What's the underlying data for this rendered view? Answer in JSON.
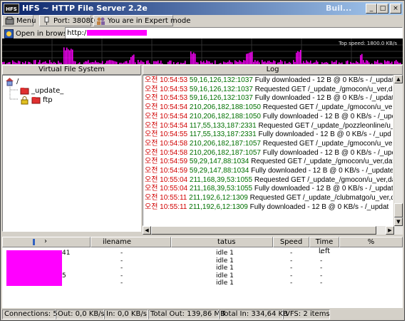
{
  "window": {
    "title": "HFS ~ HTTP File Server 2.2e",
    "title_right": "Buil...",
    "icon_label": "HFS",
    "controls": [
      "_",
      "□",
      "×"
    ]
  },
  "toolbar": {
    "menu_label": "Menu",
    "port_label": "Port: 38080",
    "mode_label": "You are in Expert mode"
  },
  "address": {
    "open_label": "Open in browser",
    "url_prefix": "http:/"
  },
  "graph": {
    "top_speed": "Top speed: 1800.0 KB/s"
  },
  "vfs": {
    "header": "Virtual File System",
    "root": "/",
    "items": [
      "_update_",
      "ftp"
    ]
  },
  "log": {
    "header": "Log",
    "entries": [
      {
        "ts": "오전 10:54:53",
        "ip": "59,16,126,132:1037",
        "msg": "Fully downloaded - 12 B @ 0 KB/s - /_update_"
      },
      {
        "ts": "오전 10:54:53",
        "ip": "59,16,126,132:1037",
        "msg": "Requested GET /_update_/gmocon/u_ver,dat"
      },
      {
        "ts": "오전 10:54:53",
        "ip": "59,16,126,132:1037",
        "msg": "Fully downloaded - 12 B @ 0 KB/s - /_update"
      },
      {
        "ts": "오전 10:54:54",
        "ip": "210,206,182,188:1050",
        "msg": "Requested GET /_update_/gmocon/u_ver,d"
      },
      {
        "ts": "오전 10:54:54",
        "ip": "210,206,182,188:1050",
        "msg": "Fully downloaded - 12 B @ 0 KB/s - /_upd"
      },
      {
        "ts": "오전 10:54:54",
        "ip": "117,55,133,187:2331",
        "msg": "Requested GET /_update_/pozzleonline/u_v"
      },
      {
        "ts": "오전 10:54:55",
        "ip": "117,55,133,187:2331",
        "msg": "Fully downloaded - 12 B @ 0 KB/s - /_upd"
      },
      {
        "ts": "오전 10:54:58",
        "ip": "210,206,182,187:1057",
        "msg": "Requested GET /_update_/gmocon/u_ver,d"
      },
      {
        "ts": "오전 10:54:58",
        "ip": "210,206,182,187:1057",
        "msg": "Fully downloaded - 12 B @ 0 KB/s - /_upd"
      },
      {
        "ts": "오전 10:54:59",
        "ip": "59,29,147,88:1034",
        "msg": "Requested GET /_update_/gmocon/u_ver,dat"
      },
      {
        "ts": "오전 10:54:59",
        "ip": "59,29,147,88:1034",
        "msg": "Fully downloaded - 12 B @ 0 KB/s - /_update"
      },
      {
        "ts": "오전 10:55:04",
        "ip": "211,168,39,53:1055",
        "msg": "Requested GET /_update_/gmocon/u_ver,dat"
      },
      {
        "ts": "오전 10:55:04",
        "ip": "211,168,39,53:1055",
        "msg": "Fully downloaded - 12 B @ 0 KB/s - /_updat"
      },
      {
        "ts": "오전 10:55:11",
        "ip": "211,192,6,12:1309",
        "msg": "Requested GET /_update_/clubmatgo/u_ver,da"
      },
      {
        "ts": "오전 10:55:11",
        "ip": "211,192,6,12:1309",
        "msg": "Fully downloaded - 12 B @ 0 KB/s - /_updat"
      }
    ]
  },
  "transfers": {
    "columns": [
      "",
      "ilename",
      "tatus",
      "Speed",
      "Time left",
      "%"
    ],
    "rows": [
      {
        "ip": "41",
        "file": "-",
        "status": "idle 1",
        "speed": "-",
        "time": "-"
      },
      {
        "ip": "",
        "file": "-",
        "status": "idle 1",
        "speed": "-",
        "time": "-"
      },
      {
        "ip": "",
        "file": "-",
        "status": "idle 1",
        "speed": "-",
        "time": "-"
      },
      {
        "ip": "5",
        "file": "-",
        "status": "idle 1",
        "speed": "-",
        "time": "-"
      },
      {
        "ip": "",
        "file": "-",
        "status": "idle 1",
        "speed": "-",
        "time": "-"
      }
    ]
  },
  "status_bar": [
    "Connections: 5",
    "Out: 0,0 KB/s",
    "In: 0,0 KB/s",
    "Total Out: 139,86 MB",
    "Total In: 334,64 KB",
    "VFS: 2 items"
  ],
  "colors": {
    "timestamp": "#d00000",
    "ip": "#007000",
    "graph_bar": "#ff00ff",
    "mask": "#ff00ff",
    "titlebar_start": "#0a246a"
  }
}
